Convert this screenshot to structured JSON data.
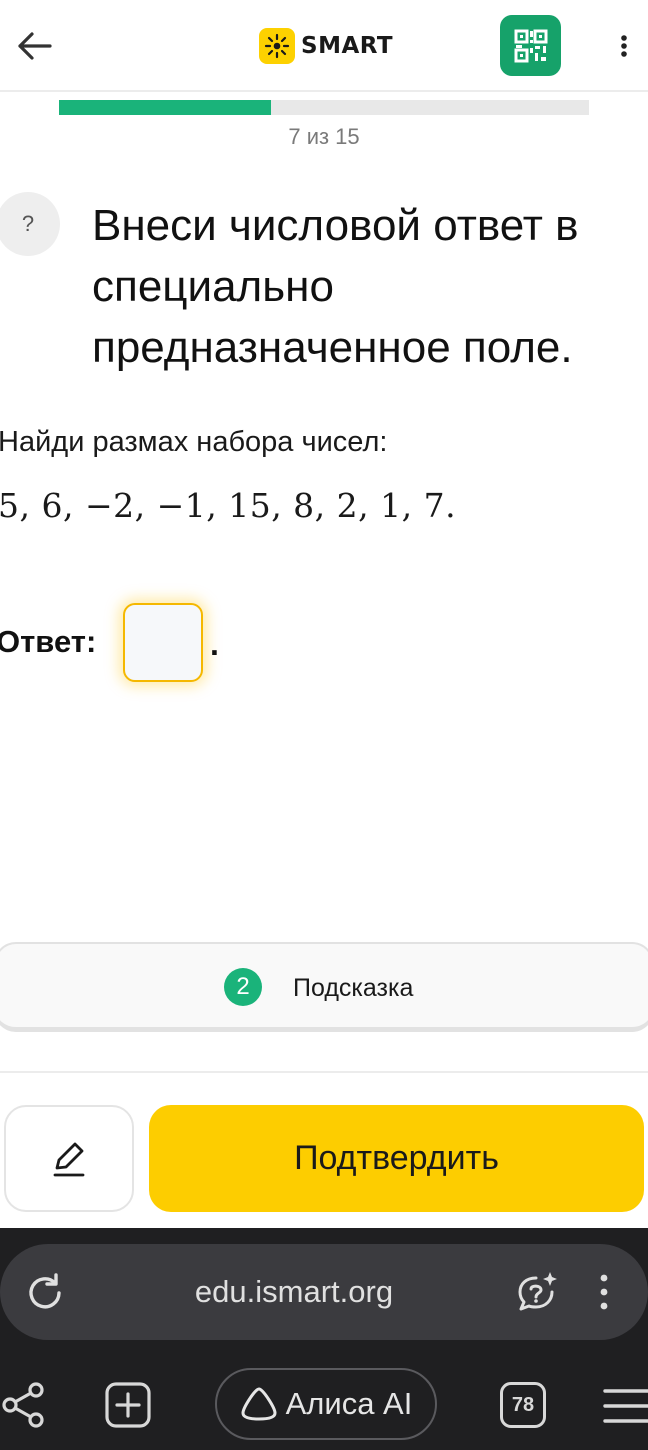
{
  "header": {
    "brand": "SMART",
    "icons": {
      "back": "arrow-left-icon",
      "qr": "qr-code-icon",
      "more": "vertical-dots-icon"
    },
    "accent_color": "#16a26a"
  },
  "progress": {
    "current": 7,
    "total": 15,
    "fill_fraction": 0.4,
    "label": "7 из 15",
    "color": "#1ab37a"
  },
  "question": {
    "help_symbol": "?",
    "title": "Внеси числовой ответ в специально предназначенное поле.",
    "task": "Найди размах набора чисел:",
    "numbers": "5,  6,  −2,  −1,  15,  8,  2,  1,  7."
  },
  "answer": {
    "label": "Ответ:",
    "value": "",
    "suffix": "."
  },
  "hint": {
    "count": "2",
    "label": "Подсказка"
  },
  "actions": {
    "draft_icon": "pencil-icon",
    "confirm_label": "Подтвердить",
    "confirm_color": "#fdcd00"
  },
  "browser": {
    "url": "edu.ismart.org",
    "alice_label": "Алиса AI",
    "tabs_count": "78",
    "icons": [
      "reload-icon",
      "alice-chat-icon",
      "vertical-dots-icon",
      "share-icon",
      "new-tab-icon",
      "alice-icon",
      "tabs-icon",
      "menu-icon"
    ]
  }
}
